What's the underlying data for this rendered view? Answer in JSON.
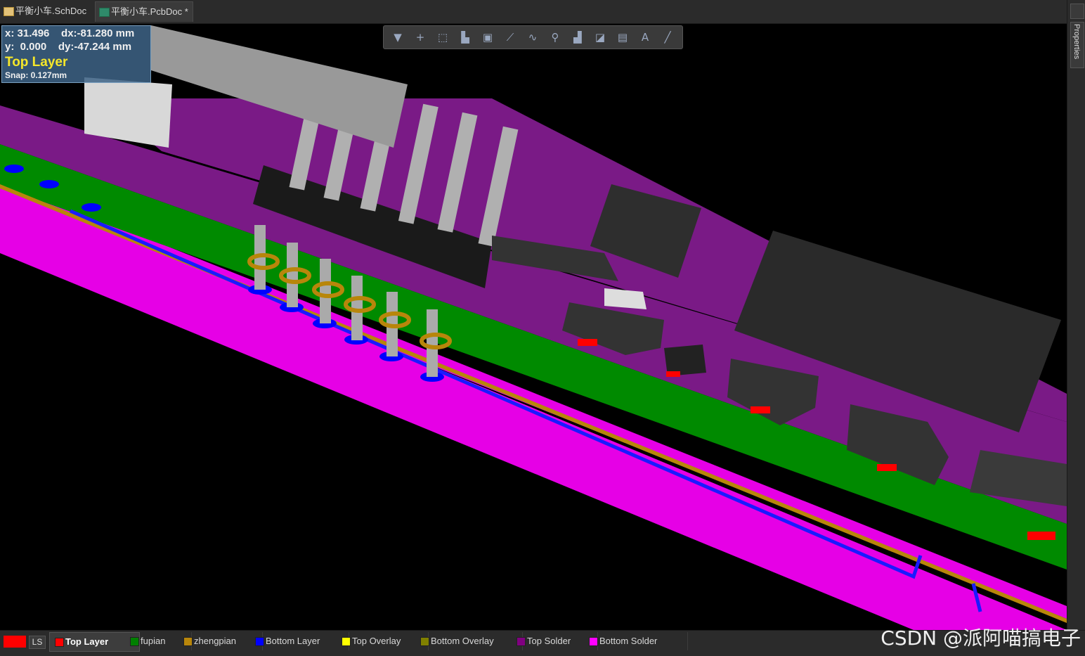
{
  "tabs": [
    {
      "label": "平衡小车.SchDoc",
      "type": "sch"
    },
    {
      "label": "平衡小车.PcbDoc *",
      "type": "pcb",
      "active": true
    }
  ],
  "side_panel": {
    "properties_label": "Properties"
  },
  "hud": {
    "x_line": "x: 31.496    dx:-81.280 mm",
    "y_line": "y:  0.000    dy:-47.244 mm",
    "layer": "Top Layer",
    "snap": "Snap: 0.127mm"
  },
  "toolbar": {
    "icons": [
      "filter-icon",
      "add-icon",
      "select-rect-icon",
      "bar-chart-icon",
      "component-icon",
      "route-icon",
      "interactive-route-icon",
      "place-pad-icon",
      "polygon-icon",
      "dimension-icon",
      "region-icon",
      "text-icon",
      "line-icon"
    ],
    "glyphs": [
      "▼",
      "+",
      "⬚",
      "▙",
      "▣",
      "⟋",
      "∿",
      "⚲",
      "▟",
      "◪",
      "▤",
      "A",
      "╱"
    ]
  },
  "layers": {
    "ls_label": "LS",
    "items": [
      {
        "label": "Top Layer",
        "color": "#ff0000",
        "active": true
      },
      {
        "label": "fupian",
        "color": "#008000"
      },
      {
        "label": "zhengpian",
        "color": "#b8860b"
      },
      {
        "label": "Bottom Layer",
        "color": "#0000ff"
      },
      {
        "label": "Top Overlay",
        "color": "#ffff00"
      },
      {
        "label": "Bottom Overlay",
        "color": "#808000"
      },
      {
        "label": "Top Solder",
        "color": "#800080"
      },
      {
        "label": "Bottom Solder",
        "color": "#ff00ff"
      }
    ]
  },
  "watermark": "CSDN @派阿喵搞电子"
}
